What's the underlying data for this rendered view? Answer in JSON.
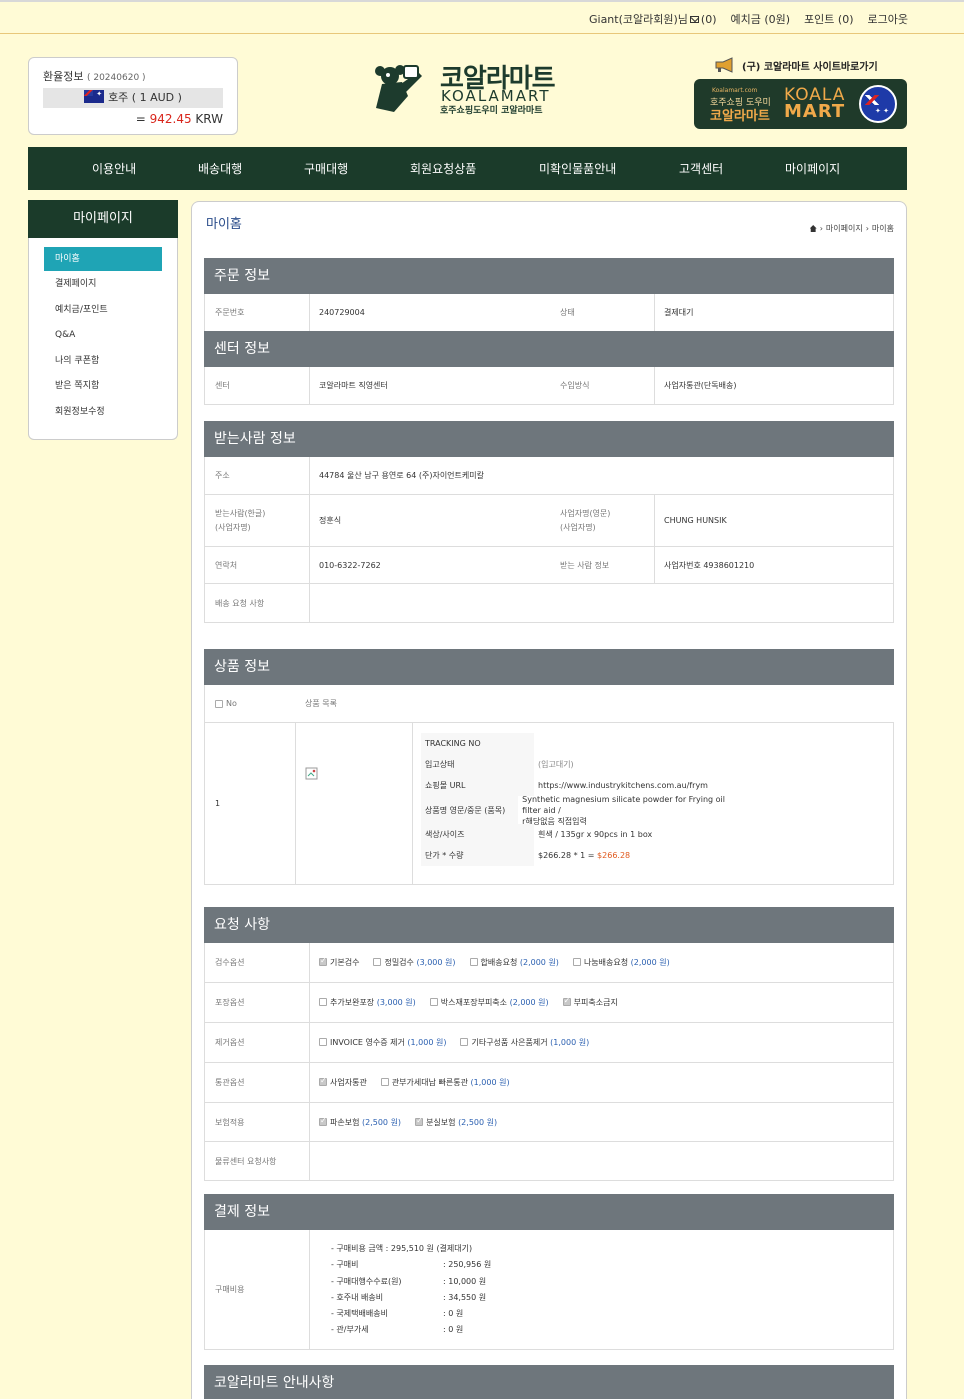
{
  "top_links": {
    "user": "Giant(코알라회원)님",
    "mail_count": "(0)",
    "deposit": "예치금 (0원)",
    "points": "포인트 (0)",
    "logout": "로그아웃"
  },
  "exchange": {
    "title": "환율정보",
    "date": "( 20240620 )",
    "currency": "호주 ( 1 AUD )",
    "eq": "= ",
    "rate": "942.45",
    "unit": " KRW"
  },
  "logo": {
    "korean": "코알라마트",
    "english": "KOALAMART",
    "tagline": "호주쇼핑도우미 코알라마트"
  },
  "old_site": {
    "link": "(구) 코알라마트 사이트바로가기",
    "banner_small": "Koalamart.com",
    "banner_mid": "호주쇼핑 도우미",
    "banner_big": "코알라마트",
    "banner_koala": "KOALA",
    "banner_mart": "MART"
  },
  "nav": [
    "이용안내",
    "배송대행",
    "구매대행",
    "회원요청상품",
    "미확인물품안내",
    "고객센터",
    "마이페이지"
  ],
  "sidebar": {
    "title": "마이페이지",
    "items": [
      "마이홈",
      "결제페이지",
      "예치금/포인트",
      "Q&A",
      "나의 쿠폰함",
      "받은 쪽지함",
      "회원정보수정"
    ]
  },
  "page": {
    "title": "마이홈",
    "breadcrumb": [
      "마이페이지",
      "마이홈"
    ]
  },
  "order_info": {
    "heading": "주문 정보",
    "order_no_label": "주문번호",
    "order_no": "240729004",
    "status_label": "상태",
    "status": "결제대기"
  },
  "center_info": {
    "heading": "센터 정보",
    "center_label": "센터",
    "center": "코알라마트 직영센터",
    "method_label": "수입방식",
    "method": "사업자통관(단독배송)"
  },
  "receiver": {
    "heading": "받는사람 정보",
    "addr_label": "주소",
    "addr": "44784 울산 남구 용연로 64 (주)자이언트케미칼",
    "name_kr_label1": "받는사람(한글)",
    "name_kr_label2": "(사업자명)",
    "name_kr": "정훈식",
    "name_en_label1": "사업자명(영문)",
    "name_en_label2": "(사업자명)",
    "name_en": "CHUNG HUNSIK",
    "phone_label": "연락처",
    "phone": "010-6322-7262",
    "recv_info_label": "받는 사람 정보",
    "recv_info": "사업자번호 4938601210",
    "req_label": "배송 요청 사항",
    "req": ""
  },
  "product": {
    "heading": "상품 정보",
    "col_no": "No",
    "col_list": "상품 목록",
    "no": "1",
    "rows": [
      {
        "k": "TRACKING NO",
        "v": ""
      },
      {
        "k": "입고상태",
        "v": "(입고대기)"
      },
      {
        "k": "쇼핑몰 URL",
        "v": "https://www.industrykitchens.com.au/frym"
      },
      {
        "k": "상품명 영문/중문 (품목)",
        "v": "Synthetic magnesium silicate powder for Frying oil filter aid /",
        "v2": "r해당없음 직접입력"
      },
      {
        "k": "색상/사이즈",
        "v": "흰색 / 135gr x 90pcs in 1 box"
      },
      {
        "k": "단가 * 수량",
        "v": "$266.28  *  1  =  ",
        "v_total": "$266.28"
      }
    ]
  },
  "request": {
    "heading": "요청 사항",
    "rows": [
      {
        "label": "검수옵션",
        "opts": [
          {
            "t": "기본검수",
            "p": "",
            "on": true
          },
          {
            "t": "정밀검수",
            "p": "(3,000 원)",
            "on": false
          },
          {
            "t": "합배송요청",
            "p": "(2,000 원)",
            "on": false
          },
          {
            "t": "나눔배송요청",
            "p": "(2,000 원)",
            "on": false
          }
        ]
      },
      {
        "label": "포장옵션",
        "opts": [
          {
            "t": "추가보완포장",
            "p": "(3,000 원)",
            "on": false
          },
          {
            "t": "박스재포장부피축소",
            "p": "(2,000 원)",
            "on": false
          },
          {
            "t": "부피축소금지",
            "p": "",
            "on": true
          }
        ]
      },
      {
        "label": "제거옵션",
        "opts": [
          {
            "t": "INVOICE 영수증 제거",
            "p": "(1,000 원)",
            "on": false
          },
          {
            "t": "기타구성품 사은품제거",
            "p": "(1,000 원)",
            "on": false
          }
        ]
      },
      {
        "label": "통관옵션",
        "opts": [
          {
            "t": "사업자통관",
            "p": "",
            "on": true
          },
          {
            "t": "관부가세대납 빠른통관",
            "p": "(1,000 원)",
            "on": false
          }
        ]
      },
      {
        "label": "보험적용",
        "opts": [
          {
            "t": "파손보험",
            "p": "(2,500 원)",
            "on": true
          },
          {
            "t": "분실보험",
            "p": "(2,500 원)",
            "on": true
          }
        ]
      },
      {
        "label": "물류센터 요청사항",
        "opts": []
      }
    ]
  },
  "payment": {
    "heading": "결제 정보",
    "label": "구매비용",
    "total": "- 구매비용 금액 : 295,510 원 (결제대기)",
    "lines": [
      {
        "a": "- 구매비",
        "b": ": 250,956 원"
      },
      {
        "a": "- 구매대행수수료(원)",
        "b": ": 10,000 원"
      },
      {
        "a": "- 호주내 배송비",
        "b": ": 34,550 원"
      },
      {
        "a": "- 국제택배배송비",
        "b": ": 0 원"
      },
      {
        "a": "- 관/부가세",
        "b": ": 0 원"
      }
    ]
  },
  "notice": {
    "heading": "코알라마트 안내사항"
  }
}
